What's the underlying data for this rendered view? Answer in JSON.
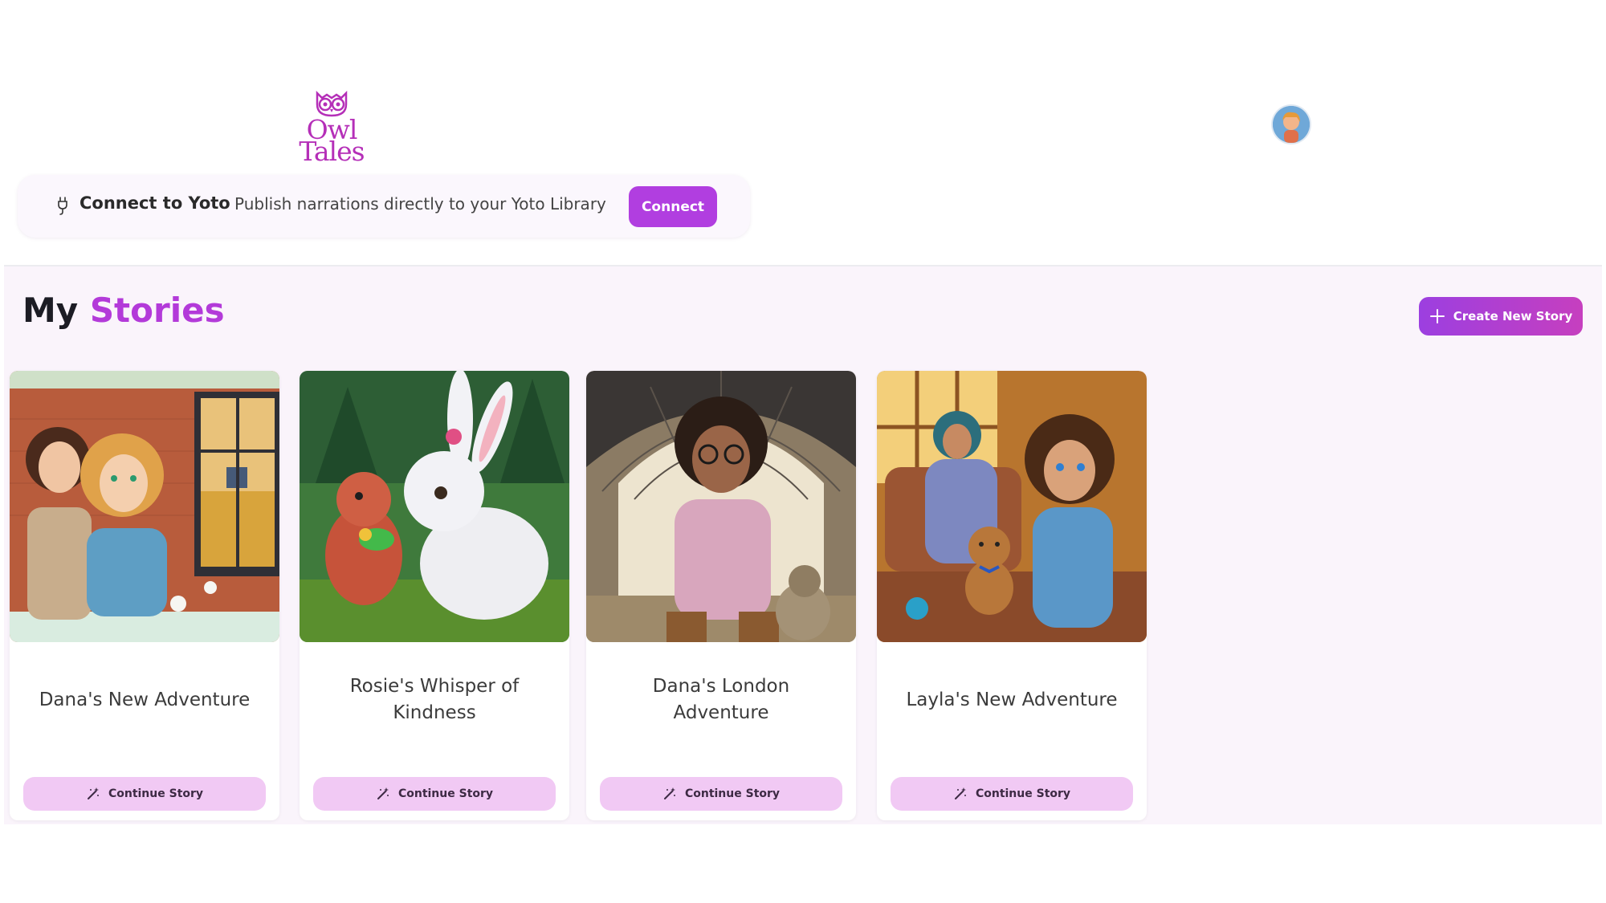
{
  "app": {
    "logo_text": "Owl Tales",
    "logo_line1": "Owl",
    "logo_line2": "Tales"
  },
  "yoto": {
    "title": "Connect to Yoto",
    "description": "Publish narrations directly to your Yoto Library",
    "connect_label": "Connect",
    "icon": "plug-icon"
  },
  "page": {
    "title_prefix": "My",
    "title_accent": "Stories",
    "create_label": "Create New Story"
  },
  "stories": [
    {
      "title": "Dana's New Adventure",
      "button": "Continue Story"
    },
    {
      "title": "Rosie's Whisper of Kindness",
      "button": "Continue Story"
    },
    {
      "title": "Dana's London Adventure",
      "button": "Continue Story"
    },
    {
      "title": "Layla's New Adventure",
      "button": "Continue Story"
    }
  ],
  "colors": {
    "brand": "#b52fb8",
    "accent": "#b33ad9",
    "button_bg": "#b13ee0",
    "continue_bg": "#f1c9f4",
    "main_bg": "#faf4fb"
  }
}
